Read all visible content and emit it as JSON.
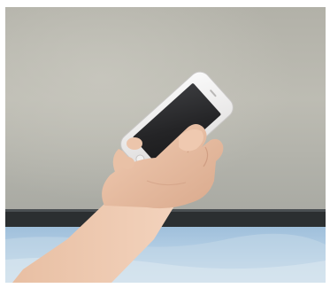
{
  "scene": {
    "subject": "hand-holding-smartphone",
    "background": "window-screen-over-sky",
    "colors": {
      "screen_mesh": "#b7b6ad",
      "screen_frame": "#2b2f31",
      "sky": "#a9c7e0",
      "phone_body": "#efeeee",
      "phone_display": "#2a2a2c",
      "skin": "#e8c0a6"
    }
  }
}
